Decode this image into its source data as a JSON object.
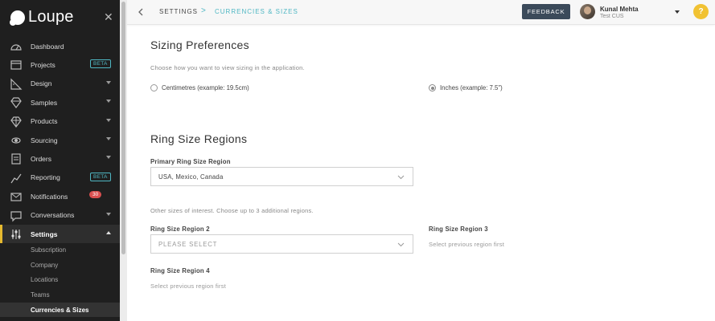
{
  "brand": {
    "name": "Loupe"
  },
  "sidebar": {
    "items": [
      {
        "label": "Dashboard",
        "icon": "dashboard-icon"
      },
      {
        "label": "Projects",
        "icon": "projects-icon",
        "badge": "BETA"
      },
      {
        "label": "Design",
        "icon": "design-icon",
        "expandable": true
      },
      {
        "label": "Samples",
        "icon": "samples-icon",
        "expandable": true
      },
      {
        "label": "Products",
        "icon": "products-icon",
        "expandable": true
      },
      {
        "label": "Sourcing",
        "icon": "sourcing-icon",
        "expandable": true
      },
      {
        "label": "Orders",
        "icon": "orders-icon",
        "expandable": true
      },
      {
        "label": "Reporting",
        "icon": "reporting-icon",
        "badge": "BETA"
      },
      {
        "label": "Notifications",
        "icon": "bell-icon",
        "count": "30"
      },
      {
        "label": "Conversations",
        "icon": "chat-icon",
        "expandable": true
      },
      {
        "label": "Settings",
        "icon": "sliders-icon",
        "active": true
      }
    ],
    "subitems": [
      {
        "label": "Subscription"
      },
      {
        "label": "Company"
      },
      {
        "label": "Locations"
      },
      {
        "label": "Teams"
      },
      {
        "label": "Currencies & Sizes",
        "active": true
      }
    ]
  },
  "header": {
    "breadcrumb_parent": "SETTINGS",
    "breadcrumb_separator": ">",
    "breadcrumb_current": "CURRENCIES & SIZES",
    "feedback_label": "FEEDBACK",
    "user_name": "Kunal Mehta",
    "user_org": "Test CUS",
    "help_label": "?"
  },
  "sizing": {
    "title": "Sizing Preferences",
    "description": "Choose how you want to view sizing in the application.",
    "option_cm": "Centimetres (example: 19.5cm)",
    "option_in": "Inches (example: 7.5\")",
    "selected": "inches"
  },
  "ring": {
    "title": "Ring Size Regions",
    "primary_label": "Primary Ring Size Region",
    "primary_value": "USA, Mexico, Canada",
    "other_help": "Other sizes of interest. Choose up to 3 additional regions.",
    "region2_label": "Ring Size Region 2",
    "region2_placeholder": "PLEASE SELECT",
    "region3_label": "Ring Size Region 3",
    "region3_note": "Select previous region first",
    "region4_label": "Ring Size Region 4",
    "region4_note": "Select previous region first"
  },
  "colors": {
    "sidebar_bg": "#1f1f1f",
    "accent_teal": "#4fb7c3",
    "accent_yellow": "#e5b92f",
    "feedback_bg": "#3b4a5a",
    "badge_red": "#d94f4f"
  }
}
